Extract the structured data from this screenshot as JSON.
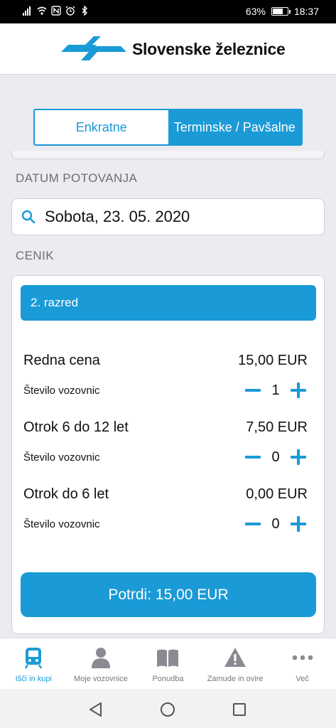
{
  "statusbar": {
    "battery": "63%",
    "time": "18:37",
    "battery_level": 0.63
  },
  "header": {
    "brand": "Slovenske železnice",
    "logo_icon": "sz-logo-icon"
  },
  "tabs": [
    {
      "label": "Enkratne",
      "active": false
    },
    {
      "label": "Terminske / Pavšalne",
      "active": true
    }
  ],
  "date_section": {
    "label": "DATUM POTOVANJA",
    "value": "Sobota, 23. 05. 2020",
    "icon": "search-icon"
  },
  "pricing": {
    "label": "CENIK",
    "class_label": "2. razred",
    "rows": [
      {
        "name": "Redna cena",
        "price": "15,00 EUR",
        "qty_label": "Število vozovnic",
        "qty": "1"
      },
      {
        "name": "Otrok 6 do 12 let",
        "price": "7,50 EUR",
        "qty_label": "Število vozovnic",
        "qty": "0"
      },
      {
        "name": "Otrok do 6 let",
        "price": "0,00 EUR",
        "qty_label": "Število vozovnic",
        "qty": "0"
      }
    ],
    "confirm_label": "Potrdi: 15,00 EUR"
  },
  "bottom_nav": [
    {
      "label": "Išči in kupi",
      "icon": "train-icon",
      "active": true
    },
    {
      "label": "Moje vozovnice",
      "icon": "user-icon",
      "active": false
    },
    {
      "label": "Ponudba",
      "icon": "book-icon",
      "active": false
    },
    {
      "label": "Zamude in ovire",
      "icon": "warning-icon",
      "active": false
    },
    {
      "label": "Več",
      "icon": "more-icon",
      "active": false
    }
  ],
  "colors": {
    "accent": "#1a9ad6",
    "background": "#ebebf0",
    "inactive_icon": "#8a8a92"
  }
}
